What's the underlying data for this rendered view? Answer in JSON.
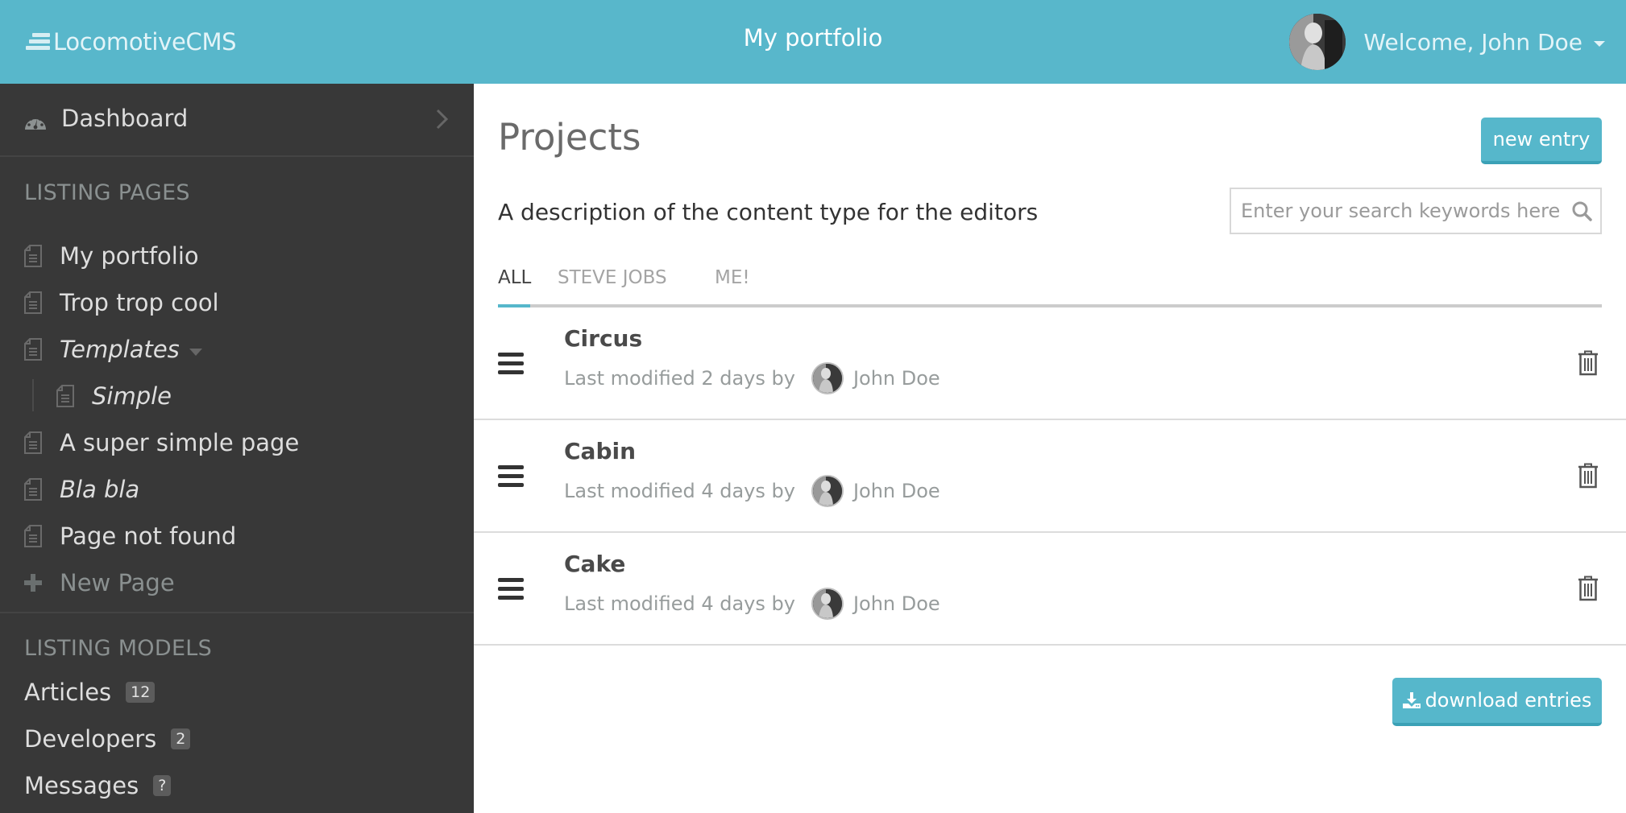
{
  "header": {
    "logo": "LocomotiveCMS",
    "site_title": "My portfolio",
    "welcome": "Welcome, John Doe",
    "icons": {
      "logo": "locomotive-logo-icon",
      "user_menu": "caret-down-icon",
      "avatar": "user-avatar"
    }
  },
  "sidebar": {
    "dashboard": {
      "label": "Dashboard",
      "icon": "dashboard-gauge-icon",
      "chevron": "chevron-right-icon"
    },
    "pages_section": "LISTING PAGES",
    "pages": [
      {
        "label": "My portfolio",
        "italic": false,
        "level": 0
      },
      {
        "label": "Trop trop cool",
        "italic": false,
        "level": 0
      },
      {
        "label": "Templates",
        "italic": true,
        "level": 0,
        "expandable": true
      },
      {
        "label": "Simple",
        "italic": true,
        "level": 1
      },
      {
        "label": "A super simple page",
        "italic": false,
        "level": 0
      },
      {
        "label": "Bla bla",
        "italic": true,
        "level": 0
      },
      {
        "label": "Page not found",
        "italic": false,
        "level": 0
      }
    ],
    "new_page": "New Page",
    "models_section": "LISTING MODELS",
    "models": [
      {
        "label": "Articles",
        "badge": "12"
      },
      {
        "label": "Developers",
        "badge": "2"
      },
      {
        "label": "Messages",
        "badge": "?"
      }
    ]
  },
  "main": {
    "title": "Projects",
    "new_entry_label": "new entry",
    "description": "A description of the content type for the editors",
    "search": {
      "placeholder": "Enter your search keywords here",
      "value": ""
    },
    "tabs": [
      {
        "label": "ALL",
        "active": true
      },
      {
        "label": "STEVE JOBS",
        "active": false
      },
      {
        "label": "ME!",
        "active": false
      }
    ],
    "entries": [
      {
        "title": "Circus",
        "meta": "Last modified 2 days by",
        "author": "John Doe"
      },
      {
        "title": "Cabin",
        "meta": "Last modified 4 days by",
        "author": "John Doe"
      },
      {
        "title": "Cake",
        "meta": "Last modified 4 days by",
        "author": "John Doe"
      }
    ],
    "download_label": "download entries"
  },
  "colors": {
    "accent": "#58b7cb",
    "accent_dark": "#3ba1b6",
    "sidebar_bg": "#383838",
    "text_dark": "#4a4a4a",
    "text_muted": "#979c9c"
  }
}
